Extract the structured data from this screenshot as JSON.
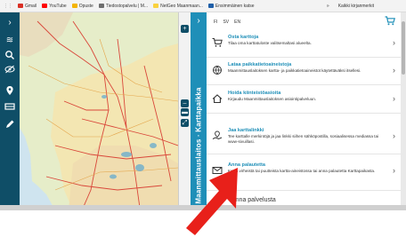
{
  "bookmarks": {
    "items": [
      {
        "label": "Gmail",
        "color": "#d93025"
      },
      {
        "label": "YouTube",
        "color": "#ff0000"
      },
      {
        "label": "Opuste",
        "color": "#f4b400"
      },
      {
        "label": "Tiedostopalvelu | M...",
        "color": "#6e6e6e"
      },
      {
        "label": "NetGeo Maanmaan...",
        "color": "#f9d13e"
      },
      {
        "label": "Ensimmäinen katse",
        "color": "#1f5fa8"
      }
    ],
    "right": [
      "»",
      "Kaikki kirjanmerkit"
    ]
  },
  "sidebar_tab": {
    "label": "Maanmittauslaitos · Karttapaikka",
    "chevron": "›"
  },
  "panel": {
    "languages": [
      "FI",
      "SV",
      "EN"
    ],
    "items": [
      {
        "title": "Osta karttoja",
        "desc": "Tilaa oma karttatuloste valitsemaltasi alueelta.",
        "icon": "cart-icon"
      },
      {
        "title": "Lataa paikkatietoaineistoja",
        "desc": "Maanmittauslaitoksen kartta- ja paikkatietoaineistot käytettäväksi itsellesi.",
        "icon": "globe-download-icon"
      },
      {
        "title": "Hoida kiinteistöasioita",
        "desc": "Kirjaudu Maanmittauslaitoksen asiointipalveluun.",
        "icon": "house-icon"
      },
      {
        "title": "Jaa karttalinkki",
        "desc": "Tee karttalle merkintöjä ja jaa linkki siihen sähköpostilla, sosiaalisessa mediassa tai www-sivuillasi.",
        "icon": "map-share-icon"
      },
      {
        "title": "Anna palautetta",
        "desc": "Kerro virheistä tai puutteista kartta-aineistossa tai anna palautetta Karttapaikasta.",
        "icon": "mail-icon"
      }
    ],
    "section_heading": "Anna palvelusta"
  },
  "colors": {
    "toolbar": "#0f4e67",
    "accent": "#1f8fb8",
    "arrow": "#e8201a"
  }
}
